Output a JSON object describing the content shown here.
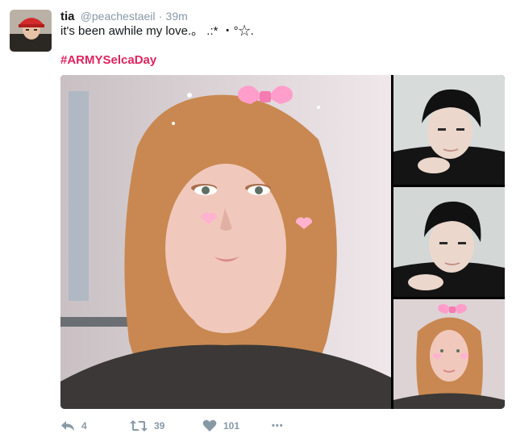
{
  "tweet": {
    "author": {
      "name": "tia",
      "handle": "@peachestaeil"
    },
    "separator": "·",
    "time": "39m",
    "text": "it's been awhile my love.。 .:* ・°☆.",
    "hashtag": "#ARMYSelcaDay",
    "colors": {
      "hashtag": "#e0245e",
      "meta": "#8899a6",
      "text": "#14171a"
    },
    "media": {
      "photos": [
        {
          "subject": "selfie-with-bow-filter"
        },
        {
          "subject": "dark-haired-person"
        },
        {
          "subject": "dark-haired-person"
        },
        {
          "subject": "selfie-with-bow-filter-small"
        }
      ]
    },
    "actions": {
      "reply": {
        "icon": "reply-icon",
        "count": "4"
      },
      "retweet": {
        "icon": "retweet-icon",
        "count": "39"
      },
      "like": {
        "icon": "heart-icon",
        "count": "101"
      },
      "more": {
        "icon": "more-icon",
        "label": "•••"
      }
    }
  }
}
